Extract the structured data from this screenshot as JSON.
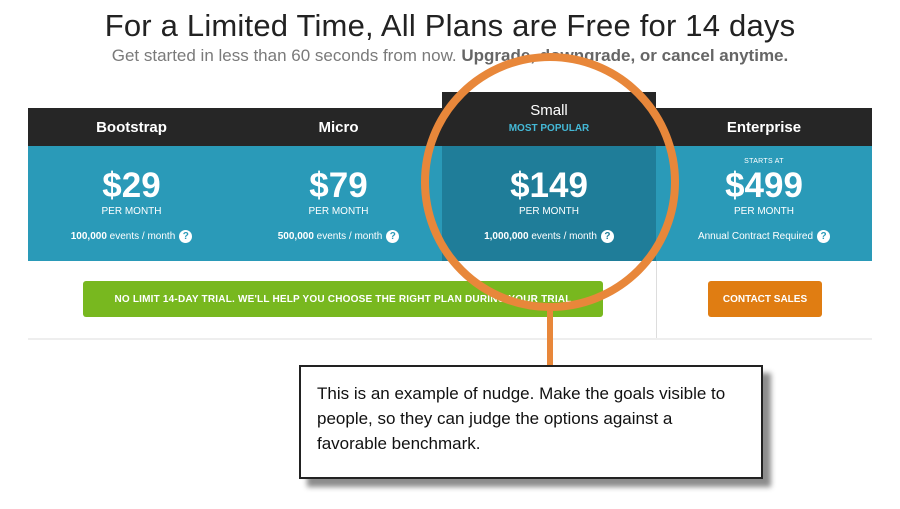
{
  "header": {
    "title": "For a Limited Time, All Plans are Free for 14 days",
    "subtitle_plain": "Get started in less than 60 seconds from now.",
    "subtitle_bold": "Upgrade, downgrade, or cancel anytime."
  },
  "plans": [
    {
      "name": "Bootstrap",
      "price": "$29",
      "period": "PER MONTH",
      "events_bold": "100,000",
      "events_rest": " events / month"
    },
    {
      "name": "Micro",
      "price": "$79",
      "period": "PER MONTH",
      "events_bold": "500,000",
      "events_rest": " events / month"
    },
    {
      "name": "Small",
      "badge": "MOST POPULAR",
      "price": "$149",
      "period": "PER MONTH",
      "events_bold": "1,000,000",
      "events_rest": " events / month"
    },
    {
      "name": "Enterprise",
      "starts_at": "STARTS AT",
      "price": "$499",
      "period": "PER MONTH",
      "events_rest": "Annual Contract Required"
    }
  ],
  "help_icon_glyph": "?",
  "buttons": {
    "trial": "NO LIMIT 14-DAY TRIAL. WE'LL HELP YOU CHOOSE THE RIGHT PLAN DURING YOUR TRIAL",
    "contact": "CONTACT SALES"
  },
  "callout": {
    "text": "This is an example of nudge. Make the goals visible to people, so they can judge the options against a favorable benchmark."
  },
  "colors": {
    "plan_blue": "#2a9ab8",
    "header_dark": "#262626",
    "trial_green": "#78b81f",
    "contact_orange": "#e07d12",
    "nudge_circle": "#e8873a",
    "popular_accent": "#44b8d6"
  }
}
